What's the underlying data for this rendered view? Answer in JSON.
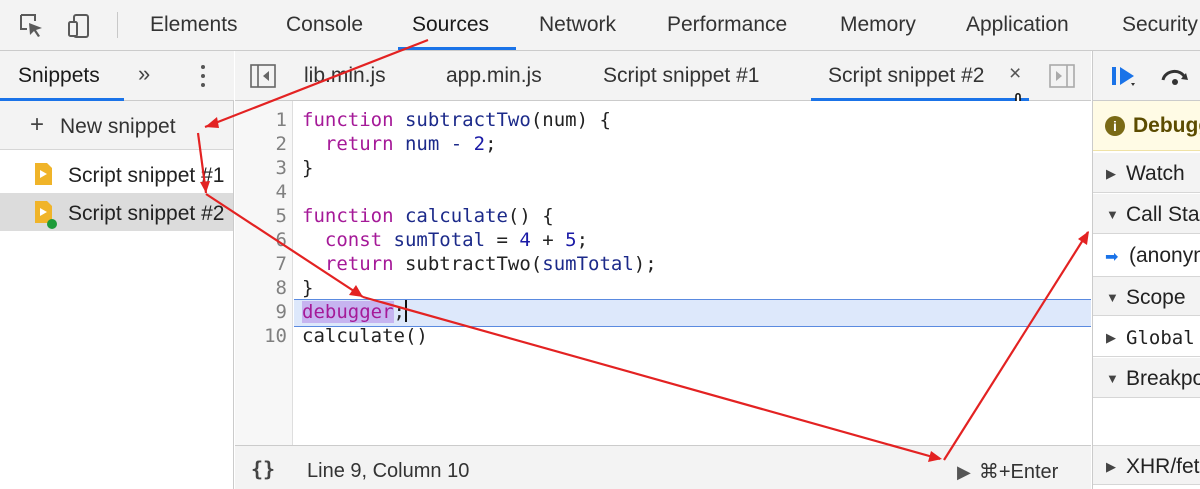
{
  "top_tabs": [
    "Elements",
    "Console",
    "Sources",
    "Network",
    "Performance",
    "Memory",
    "Application",
    "Security"
  ],
  "active_top_tab": "Sources",
  "navigator": {
    "tab_label": "Snippets",
    "more_label": "»",
    "new_snippet_label": "New snippet",
    "snippets": [
      "Script snippet #1",
      "Script snippet #2"
    ]
  },
  "editor": {
    "tabs": [
      "lib.min.js",
      "app.min.js",
      "Script snippet #1",
      "Script snippet #2"
    ],
    "active_tab": "Script snippet #2",
    "close_label": "×",
    "line_numbers": [
      "1",
      "2",
      "3",
      "4",
      "5",
      "6",
      "7",
      "8",
      "9",
      "10"
    ],
    "code": {
      "l1": {
        "kw": "function",
        "name": "subtractTwo",
        "rest": "(num) {"
      },
      "l2": {
        "kw": "return",
        "rest": " num - ",
        "num": "2",
        "end": ";"
      },
      "l3": "}",
      "l5": {
        "kw": "function",
        "name": "calculate",
        "rest": "() {"
      },
      "l6": {
        "kw": "const",
        "name": "sumTotal",
        "mid": " = ",
        "n1": "4",
        "plus": " + ",
        "n2": "5",
        "end": ";"
      },
      "l7": {
        "kw": "return",
        "rest": " subtractTwo(",
        "name": "sumTotal",
        "end": ");"
      },
      "l8": "}",
      "l9": {
        "sel": "debugger",
        "end": ";"
      },
      "l10": "calculate()"
    }
  },
  "status": {
    "pretty_print_label": "{}",
    "position": "Line 9, Column 10",
    "run_label": "⌘+Enter"
  },
  "debugger": {
    "paused_label": "Debugger paused",
    "sections": [
      "Watch",
      "Call Stack",
      "Scope",
      "Breakpoints",
      "XHR/fetch Breakpoints"
    ],
    "call_frame": "(anonymous)",
    "scope_item": "Global"
  },
  "colors": {
    "accent": "#1a73e8",
    "arrow": "#e32222",
    "keyword": "#a51998"
  }
}
